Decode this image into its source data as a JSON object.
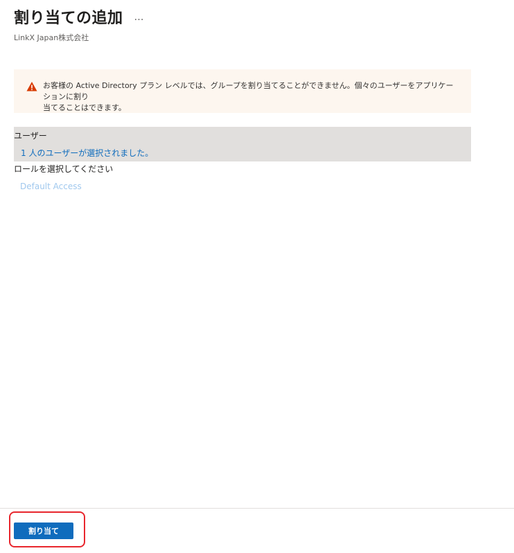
{
  "header": {
    "title": "割り当ての追加",
    "more_label": "…",
    "subtitle": "LinkX Japan株式会社"
  },
  "warning": {
    "icon": "warning-triangle-icon",
    "text_line1": "お客様の Active Directory プラン レベルでは、グループを割り当てることができません。個々のユーザーをアプリケーションに割り",
    "text_line2": "当てることはできます。",
    "color": "#d83b01"
  },
  "users": {
    "label": "ユーザー",
    "value": "1 人のユーザーが選択されました。"
  },
  "role": {
    "label": "ロールを選択してください",
    "value": "Default Access"
  },
  "footer": {
    "assign_label": "割り当て",
    "accent": "#0f6cbd",
    "highlight": "#e8262d"
  }
}
